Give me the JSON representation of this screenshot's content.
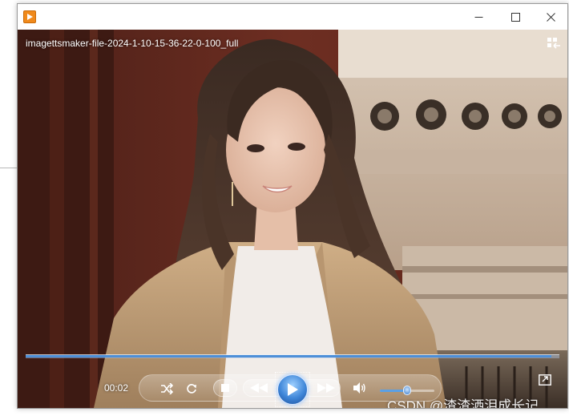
{
  "window": {
    "file_title": "imagettsmaker-file-2024-1-10-15-36-22-0-100_full",
    "app_icon": "media-player-icon",
    "buttons": {
      "minimize": "minimize-icon",
      "maximize": "maximize-icon",
      "close": "close-icon"
    }
  },
  "playback": {
    "elapsed_time": "00:02",
    "seek_progress": 0.985,
    "volume_level": 0.5
  },
  "controls": {
    "shuffle": "shuffle-icon",
    "repeat": "repeat-icon",
    "stop": "stop-icon",
    "previous": "previous-icon",
    "play": "play-icon",
    "next": "next-icon",
    "mute": "volume-icon",
    "fullscreen": "fullscreen-icon",
    "switch_view": "switch-to-library-icon"
  },
  "watermark": "CSDN @渣渣洒泪成长记",
  "colors": {
    "accent": "#4d8fd8",
    "app_icon": "#f08a1c",
    "title_text": "#ffffff"
  }
}
